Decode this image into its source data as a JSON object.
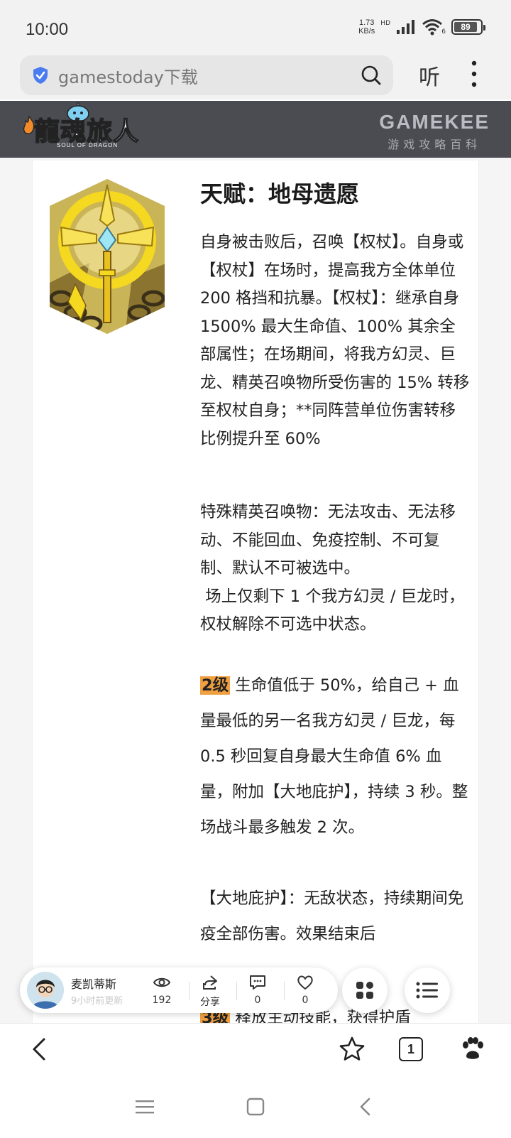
{
  "status_bar": {
    "time": "10:00",
    "net_speed_value": "1.73",
    "net_speed_unit": "KB/s",
    "hd": "HD",
    "wifi_tag": "6",
    "battery": "89",
    "battery_level": 0.89
  },
  "browser": {
    "url": "gamestoday下载",
    "listen_label": "听"
  },
  "site_header": {
    "logo_title": "龍魂旅人",
    "logo_subtitle": "SOUL OF DRAGON",
    "brand_name": "GAMEKEE",
    "brand_tagline": "游戏攻略百科"
  },
  "article": {
    "title": "天赋：地母遗愿",
    "paragraph1": "自身被击败后，召唤【权杖】。自身或【权杖】在场时，提高我方全体单位 200 格挡和抗暴。【权杖】：继承自身 1500% 最大生命值、100% 其余全部属性；在场期间，将我方幻灵、巨龙、精英召唤物所受伤害的 15% 转移至权杖自身；**同阵营单位伤害转移比例提升至 60%",
    "paragraph2": "特殊精英召唤物：无法攻击、无法移动、不能回血、免疫控制、不可复制、默认不可被选中。\n 场上仅剩下 1 个我方幻灵 / 巨龙时，权杖解除不可选中状态。",
    "level2_badge": "2级",
    "level2_text": " 生命值低于 50%，给自己 + 血量最低的另一名我方幻灵 / 巨龙，每 0.5 秒回复自身最大生命值 6% 血量，附加【大地庇护】，持续 3 秒。整场战斗最多触发 2 次。",
    "protection_text": "【大地庇护】：无敌状态，持续期间免疫全部伤害。效果结束后",
    "protection_tail": "【",
    "level3_badge": "3级",
    "level3_text": " 释放主动技能，获得护盾"
  },
  "author_bar": {
    "name": "麦凯蒂斯",
    "updated": "9小时前更新",
    "views": "192",
    "share_label": "分享",
    "comments": "0",
    "likes": "0"
  },
  "bottom_bar": {
    "tab_count": "1"
  },
  "colors": {
    "header_bg": "#4a4c52",
    "badge_orange": "#f0a040",
    "accent_blue": "#4a7cf0"
  }
}
